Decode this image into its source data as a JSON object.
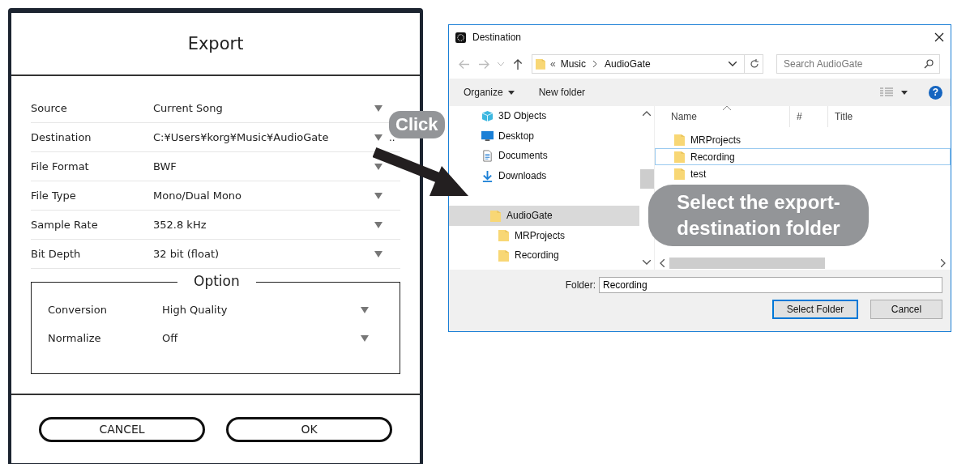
{
  "export_dialog": {
    "title": "Export",
    "settings": [
      {
        "label": "Source",
        "value": "Current Song"
      },
      {
        "label": "Destination",
        "value": "C:¥Users¥korg¥Music¥AudioGate",
        "browse": ".."
      },
      {
        "label": "File Format",
        "value": "BWF"
      },
      {
        "label": "File Type",
        "value": "Mono/Dual Mono"
      },
      {
        "label": "Sample Rate",
        "value": "352.8 kHz"
      },
      {
        "label": "Bit Depth",
        "value": "32 bit (float)"
      }
    ],
    "option_group": {
      "title": "Option",
      "settings": [
        {
          "label": "Conversion",
          "value": "High Quality"
        },
        {
          "label": "Normalize",
          "value": "Off"
        }
      ]
    },
    "buttons": [
      "CANCEL",
      "OK"
    ]
  },
  "callouts": [
    "Click",
    "Select the export-destination folder"
  ],
  "folder_dialog": {
    "title": "Destination",
    "breadcrumb": {
      "overflow": "«",
      "path": [
        "Music",
        "AudioGate"
      ]
    },
    "search": {
      "placeholder": "Search AudioGate"
    },
    "toolbar": {
      "organize": "Organize",
      "new_folder": "New folder",
      "help": "?"
    },
    "nav_tree": [
      {
        "label": "3D Objects",
        "kind": "cube",
        "selected": false
      },
      {
        "label": "Desktop",
        "kind": "desktop",
        "selected": false
      },
      {
        "label": "Documents",
        "kind": "document",
        "selected": false
      },
      {
        "label": "Downloads",
        "kind": "download",
        "selected": false
      },
      {
        "selected": false,
        "children": [
          {
            "label": "AudioGate",
            "kind": "folder",
            "selected": true,
            "children": [
              {
                "label": "MRProjects",
                "kind": "folder",
                "selected": false
              },
              {
                "label": "Recording",
                "kind": "folder",
                "selected": false
              }
            ]
          }
        ]
      }
    ],
    "columns": [
      "Name",
      "#",
      "Title"
    ],
    "files": [
      {
        "name": "MRProjects",
        "selected": false
      },
      {
        "name": "Recording",
        "selected": true
      },
      {
        "name": "test",
        "selected": false
      }
    ],
    "folder_label": "Folder:",
    "folder_value": "Recording",
    "buttons": [
      "Select Folder",
      "Cancel"
    ]
  }
}
